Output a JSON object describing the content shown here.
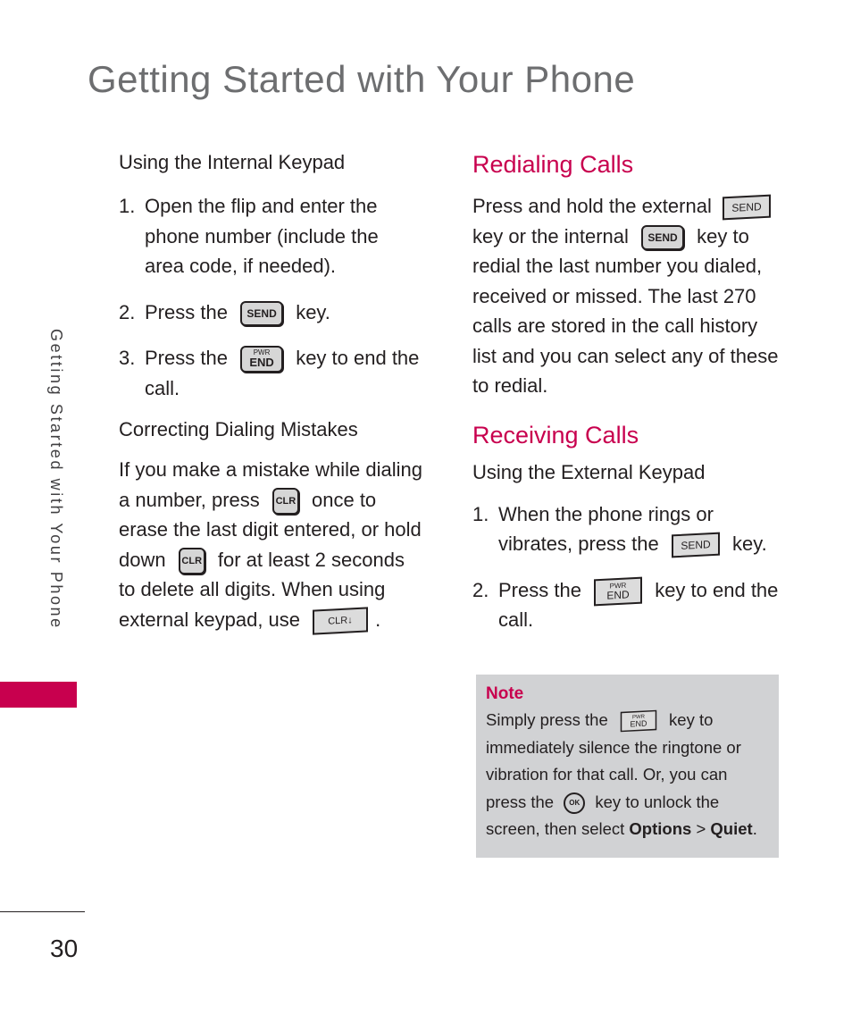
{
  "page": {
    "title": "Getting Started with Your Phone",
    "side_tab": "Getting Started with Your Phone",
    "page_number": "30",
    "accent_color": "#c8004e"
  },
  "left": {
    "internal_heading": "Using the Internal Keypad",
    "steps": [
      {
        "num": "1.",
        "text": "Open the flip and enter the phone number (include the area code, if needed)."
      },
      {
        "num": "2.",
        "before": "Press the",
        "key": "SEND",
        "after": "key."
      },
      {
        "num": "3.",
        "before": "Press the",
        "key_top": "PWR",
        "key": "END",
        "after": "key to end the call."
      }
    ],
    "correcting_heading": "Correcting Dialing Mistakes",
    "correcting": {
      "part1": "If you make a mistake while dialing a number, press",
      "key1": "CLR",
      "part2": "once to erase the last digit entered, or hold down",
      "key2": "CLR",
      "part3": "for at least 2 seconds to delete all digits. When using external keypad, use",
      "key3": "CLR↓",
      "part4": "."
    }
  },
  "right": {
    "redialing_heading": "Redialing Calls",
    "redialing": {
      "part1": "Press and hold the external",
      "key_ext": "SEND",
      "part2": "key or the internal",
      "key_int": "SEND",
      "part3": "key to redial the last number you dialed, received or missed. The last 270 calls are stored in the call history list and you can select any of these to redial."
    },
    "receiving_heading": "Receiving Calls",
    "external_heading": "Using the External Keypad",
    "steps": [
      {
        "num": "1.",
        "before": "When the phone rings or vibrates, press the",
        "key": "SEND",
        "after": "key."
      },
      {
        "num": "2.",
        "before": "Press the",
        "key_top": "PWR",
        "key": "END",
        "after": "key to end the call."
      }
    ]
  },
  "note": {
    "title": "Note",
    "part1": "Simply press the",
    "key_top": "PWR",
    "key": "END",
    "part2": "key to immediately silence the ringtone or vibration for that call. Or, you can press the",
    "ok_key": "OK",
    "part3": "key to unlock the screen, then select",
    "options": "Options",
    "sep": " > ",
    "quiet": "Quiet",
    "end": "."
  }
}
